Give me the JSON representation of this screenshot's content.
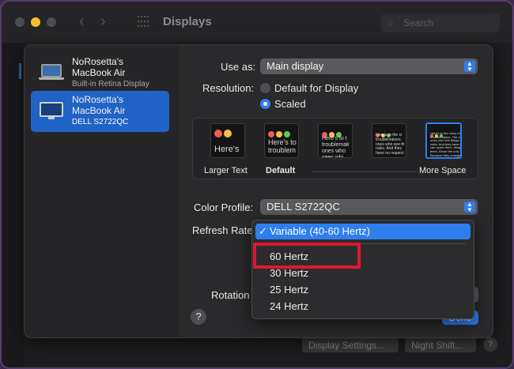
{
  "window": {
    "title": "Displays",
    "search_placeholder": "Search"
  },
  "background_buttons": {
    "display_settings": "Display Settings...",
    "night_shift": "Night Shift...",
    "help": "?"
  },
  "sidebar": {
    "items": [
      {
        "name_line1": "NoRosetta's",
        "name_line2": "MacBook Air",
        "subtitle": "Built-in Retina Display",
        "selected": false
      },
      {
        "name_line1": "NoRosetta's",
        "name_line2": "MacBook Air",
        "subtitle": "DELL S2722QC",
        "selected": true
      }
    ]
  },
  "settings": {
    "use_as_label": "Use as:",
    "use_as_value": "Main display",
    "resolution_label": "Resolution:",
    "resolution_options": [
      "Default for Display",
      "Scaled"
    ],
    "resolution_selected": "Scaled",
    "thumbnails": [
      {
        "text": "Here's"
      },
      {
        "text": "Here's to\ntroublem"
      },
      {
        "text": "Here's to t\ntroublemak\nones who\nsees whi"
      },
      {
        "text": "Here's to the cr\ntroublemakers.\nones who see th\nrules. And they\nhave no respect"
      },
      {
        "text": "Here's to the crazy one\ntroublemakers. The ro\nones who see things di\nrules. And they have no\ncan quote them, disagr\nthem. About the only th\nBecause they change th"
      }
    ],
    "scale_labels": {
      "left": "Larger Text",
      "default": "Default",
      "right": "More Space"
    },
    "color_profile_label": "Color Profile:",
    "color_profile_value": "DELL S2722QC",
    "refresh_rate_label": "Refresh Rate",
    "rotation_label": "Rotation",
    "done_label": "Done",
    "help_label": "?"
  },
  "refresh_menu": {
    "selected": "Variable (40-60 Hertz)",
    "checkmark": "✓",
    "options": [
      "60 Hertz",
      "30 Hertz",
      "25 Hertz",
      "24 Hertz"
    ],
    "highlighted_option": "60 Hertz"
  },
  "colors": {
    "accent": "#2f7ef0",
    "highlight_box": "#e0182d",
    "selected_sidebar": "#1f63c6"
  }
}
